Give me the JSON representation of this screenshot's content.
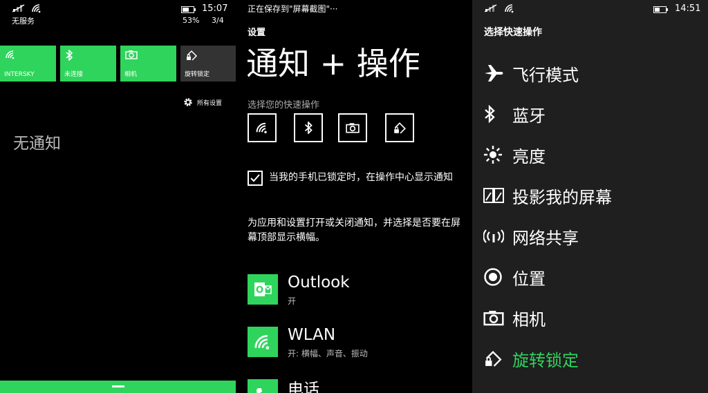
{
  "panel1": {
    "status": {
      "carrier": "无服务",
      "time": "15:07",
      "battery": "53%",
      "page": "3/4"
    },
    "tiles": [
      {
        "label": "INTERSKY",
        "icon": "wifi-icon"
      },
      {
        "label": "未连接",
        "icon": "bluetooth-icon"
      },
      {
        "label": "相机",
        "icon": "camera-icon"
      },
      {
        "label": "旋转锁定",
        "icon": "rotation-lock-icon"
      }
    ],
    "all_settings": "所有设置",
    "no_notifications": "无通知",
    "colors": {
      "accent": "#2fd45c",
      "tile_inactive": "#333333"
    }
  },
  "panel2": {
    "saving": "正在保存到\"屏幕截图\"···",
    "settings_label": "设置",
    "title": "通知 + 操作",
    "quick_actions_label": "选择您的快速操作",
    "quick_actions": [
      "wifi-icon",
      "bluetooth-icon",
      "camera-icon",
      "rotation-lock-icon"
    ],
    "lock_checkbox_label": "当我的手机已锁定时，在操作中心显示通知",
    "lock_checkbox_checked": true,
    "description": "为应用和设置打开或关闭通知，并选择是否要在屏幕顶部显示横幅。",
    "apps": [
      {
        "name": "Outlook",
        "sub": "开",
        "icon": "outlook-icon"
      },
      {
        "name": "WLAN",
        "sub": "开: 横幅、声音、振动",
        "icon": "wifi-icon"
      },
      {
        "name": "电话",
        "sub": "",
        "icon": "phone-icon"
      }
    ]
  },
  "panel3": {
    "status": {
      "time": "14:51"
    },
    "heading": "选择快速操作",
    "items": [
      {
        "label": "飞行模式",
        "icon": "airplane-icon"
      },
      {
        "label": "蓝牙",
        "icon": "bluetooth-icon"
      },
      {
        "label": "亮度",
        "icon": "brightness-icon"
      },
      {
        "label": "投影我的屏幕",
        "icon": "project-screen-icon"
      },
      {
        "label": "网络共享",
        "icon": "hotspot-icon"
      },
      {
        "label": "位置",
        "icon": "location-icon"
      },
      {
        "label": "相机",
        "icon": "camera-icon"
      },
      {
        "label": "旋转锁定",
        "icon": "rotation-lock-icon",
        "selected": true
      }
    ],
    "selected_color": "#2fd45c"
  }
}
